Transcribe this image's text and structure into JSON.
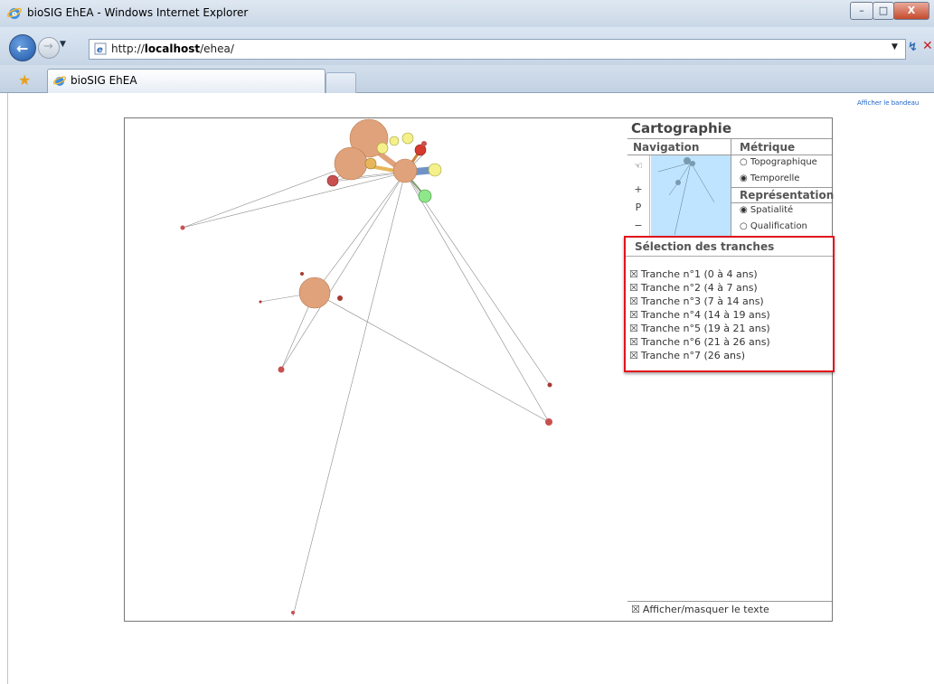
{
  "window": {
    "title": "bioSIG EhEA - Windows Internet Explorer",
    "min_label": "–",
    "max_label": "□",
    "close_label": "X"
  },
  "navbar": {
    "back_glyph": "←",
    "forward_glyph": "→",
    "history_glyph": "▼",
    "url_prefix": "http://",
    "url_host": "localhost",
    "url_path": "/ehea/",
    "dropdown_glyph": "▼",
    "refresh_glyph": "↯",
    "stop_glyph": "✕"
  },
  "tabs": {
    "favorites_glyph": "★",
    "active_title": "bioSIG EhEA"
  },
  "page": {
    "bandeau_link": "Afficher le bandeau"
  },
  "panel": {
    "title": "Cartographie",
    "navigation_header": "Navigation",
    "metrique_header": "Métrique",
    "representation_header": "Représentation",
    "tools": [
      {
        "name": "pan-hand-icon",
        "glyph": "☜"
      },
      {
        "name": "zoom-in-button",
        "glyph": "+"
      },
      {
        "name": "p-button",
        "glyph": "P"
      },
      {
        "name": "zoom-out-button",
        "glyph": "−"
      }
    ],
    "metrique_options": [
      {
        "label": "Topographique",
        "selected": false
      },
      {
        "label": "Temporelle",
        "selected": true
      }
    ],
    "representation_options": [
      {
        "label": "Spatialité",
        "selected": true
      },
      {
        "label": "Qualification",
        "selected": false
      }
    ],
    "radio_on": "◉",
    "radio_off": "○",
    "show_text_toggle": "Afficher/masquer le texte"
  },
  "tranches": {
    "header": "Sélection des tranches",
    "checkbox_glyph": "☒",
    "items": [
      "Tranche n°1 (0 à 4 ans)",
      "Tranche n°2 (4 à 7 ans)",
      "Tranche n°3 (7 à 14 ans)",
      "Tranche n°4 (14 à 19 ans)",
      "Tranche n°5 (19 à 21 ans)",
      "Tranche n°6 (21 à 26 ans)",
      "Tranche n°7 (26 ans)"
    ]
  },
  "colors": {
    "node_tan": "#e0a27a",
    "node_red": "#c9504f",
    "node_yellow": "#f4f08a",
    "node_green": "#8ee88a",
    "node_orange": "#e8b65a",
    "link": "#8a8a8a",
    "highlight_border": "#e0141c",
    "minimap_bg": "#bfe4ff"
  }
}
